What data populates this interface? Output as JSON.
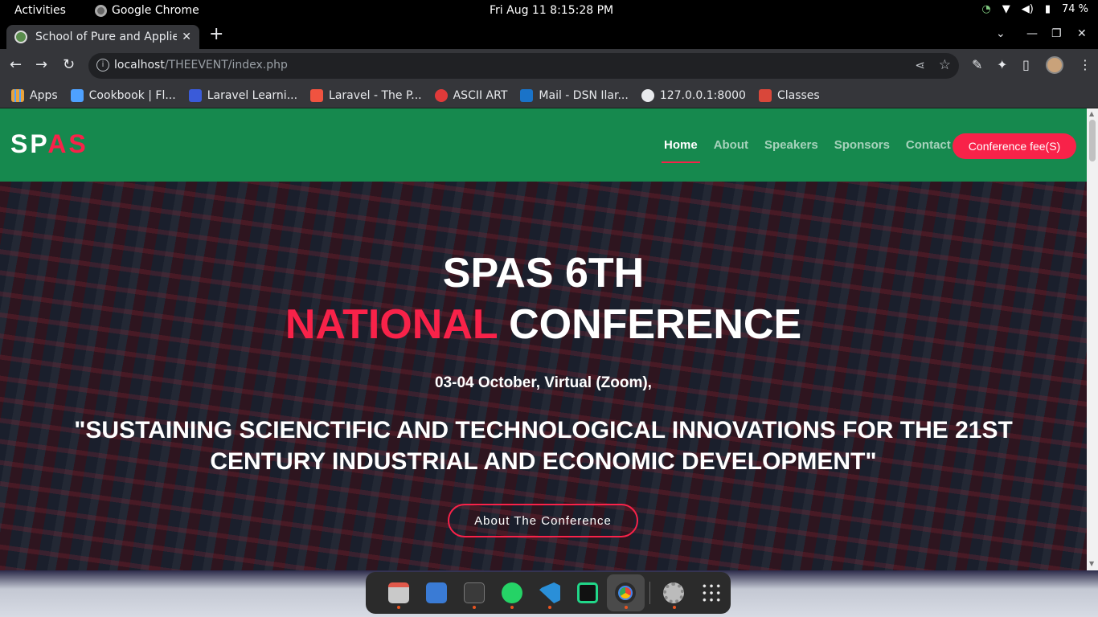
{
  "system_bar": {
    "activities": "Activities",
    "app_name": "Google Chrome",
    "clock": "Fri Aug 11   8:15:28 PM",
    "battery": "74 %"
  },
  "browser": {
    "tab_title": "School of Pure and Applie",
    "url_host": "localhost",
    "url_path": "/THEEVENT/index.php",
    "bookmarks": [
      {
        "label": "Apps",
        "color": "#e8a33d"
      },
      {
        "label": "Cookbook | Fl...",
        "color": "#4ea1ff"
      },
      {
        "label": "Laravel Learni...",
        "color": "#3a5bd9"
      },
      {
        "label": "Laravel - The P...",
        "color": "#f05340"
      },
      {
        "label": "ASCII ART",
        "color": "#e03a3a"
      },
      {
        "label": "Mail - DSN Ilar...",
        "color": "#1a73c8"
      },
      {
        "label": "127.0.0.1:8000",
        "color": "#e8eaed"
      },
      {
        "label": "Classes",
        "color": "#d9473a"
      }
    ]
  },
  "site": {
    "logo_white": "SP",
    "logo_red": "AS",
    "nav": [
      "Home",
      "About",
      "Speakers",
      "Sponsors",
      "Contact"
    ],
    "fee_button": "Conference fee(S)",
    "hero": {
      "line1": "SPAS 6TH",
      "line2_red": "NATIONAL",
      "line2_white": " CONFERENCE",
      "date": "03-04 October, Virtual (Zoom),",
      "theme": "\"SUSTAINING SCIENCTIFIC AND TECHNOLOGICAL INNOVATIONS FOR THE 21ST CENTURY INDUSTRIAL AND ECONOMIC DEVELOPMENT\"",
      "about_button": "About The Conference"
    },
    "colors": {
      "header_green": "#16894e",
      "accent_red": "#f82249"
    }
  },
  "dock": {
    "apps": [
      "files-icon",
      "text-editor-icon",
      "terminal-icon",
      "whatsapp-icon",
      "vscode-icon",
      "pycharm-icon",
      "chrome-icon",
      "settings-icon",
      "app-grid-icon"
    ]
  }
}
